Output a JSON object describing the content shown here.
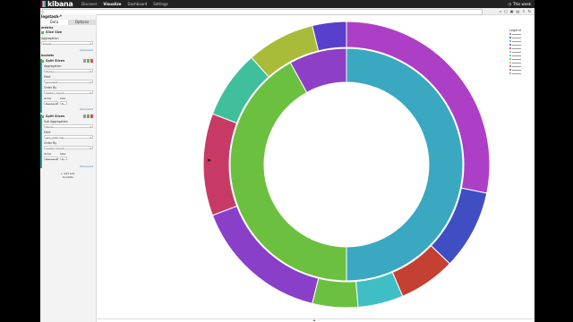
{
  "nav": {
    "logo": "kibana",
    "items": [
      "Discover",
      "Visualize",
      "Dashboard",
      "Settings"
    ],
    "active": "Visualize",
    "time": "This week"
  },
  "search": {
    "placeholder": "*"
  },
  "sidebar": {
    "title": "logstash-*",
    "tabs": [
      "Data",
      "Options"
    ],
    "metrics_label": "metrics",
    "slice_size": "Slice Size",
    "aggregation_label": "Aggregation",
    "aggregation_value": "Count",
    "advanced": "Advanced",
    "buckets_label": "buckets",
    "split_slices": "Split Slices",
    "aggregation_value_2": "Terms",
    "field_label": "Field",
    "field_value": "geo.dest",
    "order_by_label": "Order By",
    "order_by_value": "metric: Count",
    "order_label": "Order",
    "size_label": "Size",
    "order_value": "Descendi",
    "size_value": "5",
    "advanced_2": "Advanced",
    "split_slices_2": "Split Slices",
    "sub_aggregation_label": "Sub Aggregation",
    "sub_aggregation_value": "Terms",
    "field_label_2": "Field",
    "field_value_2": "geo_path.raw",
    "order_by_label_2": "Order By",
    "order_by_value_2": "metric: Count",
    "order_label_2": "Order",
    "size_label_2": "Size",
    "order_value_2": "Descendi",
    "size_value_2": "5",
    "advanced_3": "Advanced",
    "add_sub": "Add sub-buckets"
  },
  "legend": {
    "title": "Legend",
    "colors": [
      "#b04ecb",
      "#5b3fcf",
      "#3ab0c8",
      "#3b4cc0",
      "#c0423a",
      "#44c1c8",
      "#6bbf3a",
      "#3fbf9b",
      "#a8bb3a",
      "#c3365e",
      "#8c3fc8",
      "#4fae9c"
    ]
  },
  "chart_data": {
    "type": "pie",
    "donut": true,
    "inner_ring": {
      "colors": [
        "#3aa8c0",
        "#6cc040",
        "#8e3fc8"
      ],
      "values": [
        50,
        42,
        8
      ]
    },
    "outer_ring": {
      "colors": [
        "#ad3fc6",
        "#3f4fc3",
        "#c44032",
        "#3fbfc5",
        "#6cc040",
        "#8a3fc9",
        "#c83a66",
        "#3fbf9c",
        "#a9bb38",
        "#5a3fcc"
      ],
      "values": [
        22,
        7,
        5,
        4,
        4,
        12,
        9,
        6,
        6,
        3
      ]
    }
  }
}
